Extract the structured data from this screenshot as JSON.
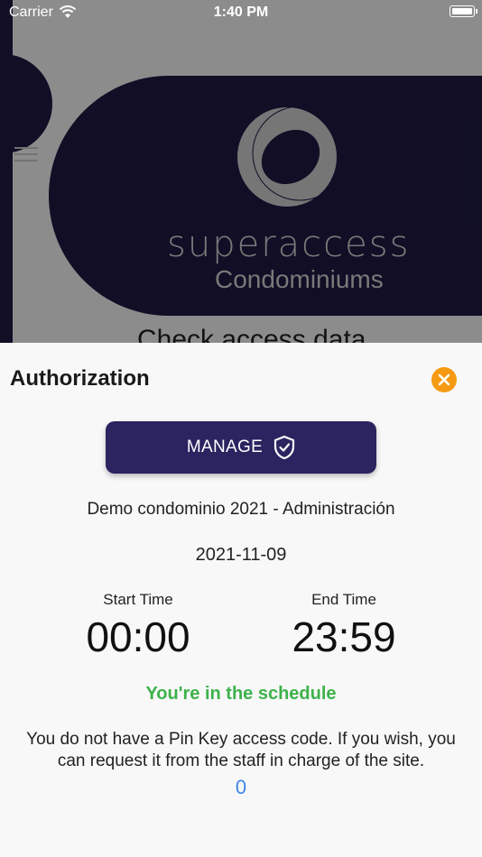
{
  "status_bar": {
    "carrier": "Carrier",
    "time": "1:40 PM"
  },
  "background": {
    "brand": "superaccess",
    "subtitle": "Condominiums",
    "partial_heading": "Check access data"
  },
  "sheet": {
    "title": "Authorization",
    "manage_label": "MANAGE",
    "condo_name": "Demo condominio 2021 - Administración",
    "date": "2021-11-09",
    "start_label": "Start Time",
    "start_value": "00:00",
    "end_label": "End Time",
    "end_value": "23:59",
    "schedule_status": "You're in the schedule",
    "pin_message": "You do not have a Pin Key access code. If you wish, you can request it from the staff in charge of the site.",
    "pin_value": "0"
  },
  "colors": {
    "brand_navy": "#1f1b45",
    "button": "#2b2460",
    "close": "#f59a12",
    "success": "#3db24a",
    "link": "#3f86e8"
  },
  "icons": {
    "close": "close-icon",
    "shield": "shield-check-icon",
    "menu": "hamburger-icon",
    "wifi": "wifi-icon",
    "battery": "battery-icon"
  }
}
